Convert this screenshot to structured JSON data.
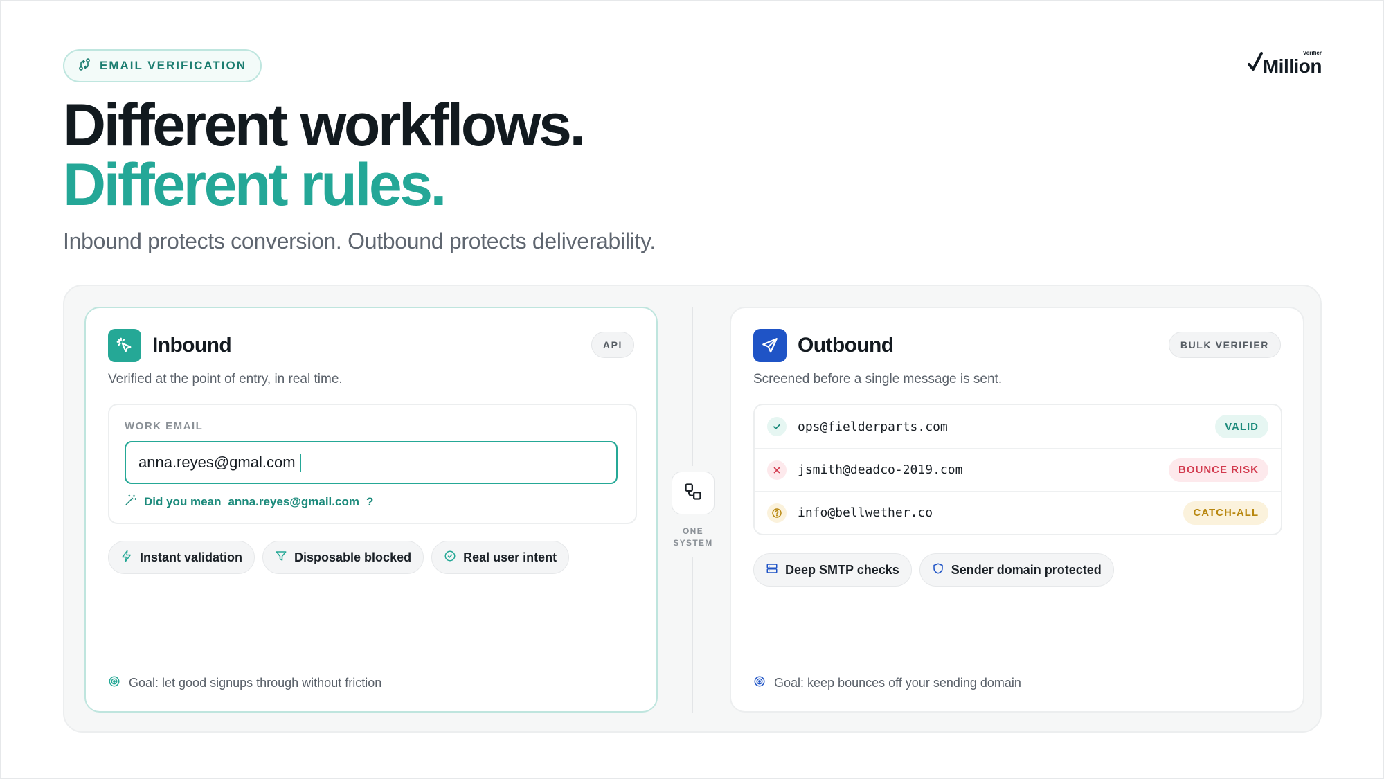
{
  "header": {
    "pill_label": "EMAIL VERIFICATION",
    "logo_word": "Million",
    "logo_small": "Verifier",
    "title_line1": "Different workflows.",
    "title_line2": "Different rules.",
    "subtitle": "Inbound protects conversion. Outbound protects deliverability."
  },
  "inbound": {
    "title": "Inbound",
    "tag": "API",
    "description": "Verified at the point of entry, in real time.",
    "field_label": "WORK EMAIL",
    "field_value": "anna.reyes@gmal.com",
    "suggest_prefix": "Did you mean",
    "suggest_email": "anna.reyes@gmail.com",
    "suggest_suffix": "?",
    "chips": [
      {
        "label": "Instant validation",
        "icon": "bolt-icon"
      },
      {
        "label": "Disposable blocked",
        "icon": "filter-icon"
      },
      {
        "label": "Real user intent",
        "icon": "check-circle-icon"
      }
    ],
    "goal": "Goal: let good signups through without friction"
  },
  "connector": {
    "label_line1": "ONE",
    "label_line2": "SYSTEM"
  },
  "outbound": {
    "title": "Outbound",
    "tag": "BULK VERIFIER",
    "description": "Screened before a single message is sent.",
    "rows": [
      {
        "email": "ops@fielderparts.com",
        "status": "VALID",
        "icon": "check-icon",
        "color": "#1b8a7b",
        "bg": "#e6f6f2"
      },
      {
        "email": "jsmith@deadco-2019.com",
        "status": "BOUNCE RISK",
        "icon": "x-icon",
        "color": "#d23a4e",
        "bg": "#fde9ec"
      },
      {
        "email": "info@bellwether.co",
        "status": "CATCH-ALL",
        "icon": "question-icon",
        "color": "#b8870f",
        "bg": "#fbf2dc"
      }
    ],
    "chips": [
      {
        "label": "Deep SMTP checks",
        "icon": "server-icon"
      },
      {
        "label": "Sender domain protected",
        "icon": "shield-icon"
      }
    ],
    "goal": "Goal: keep bounces off your sending domain"
  },
  "colors": {
    "teal": "#25a896",
    "blue": "#1f54c6",
    "dark": "#121a1f"
  }
}
